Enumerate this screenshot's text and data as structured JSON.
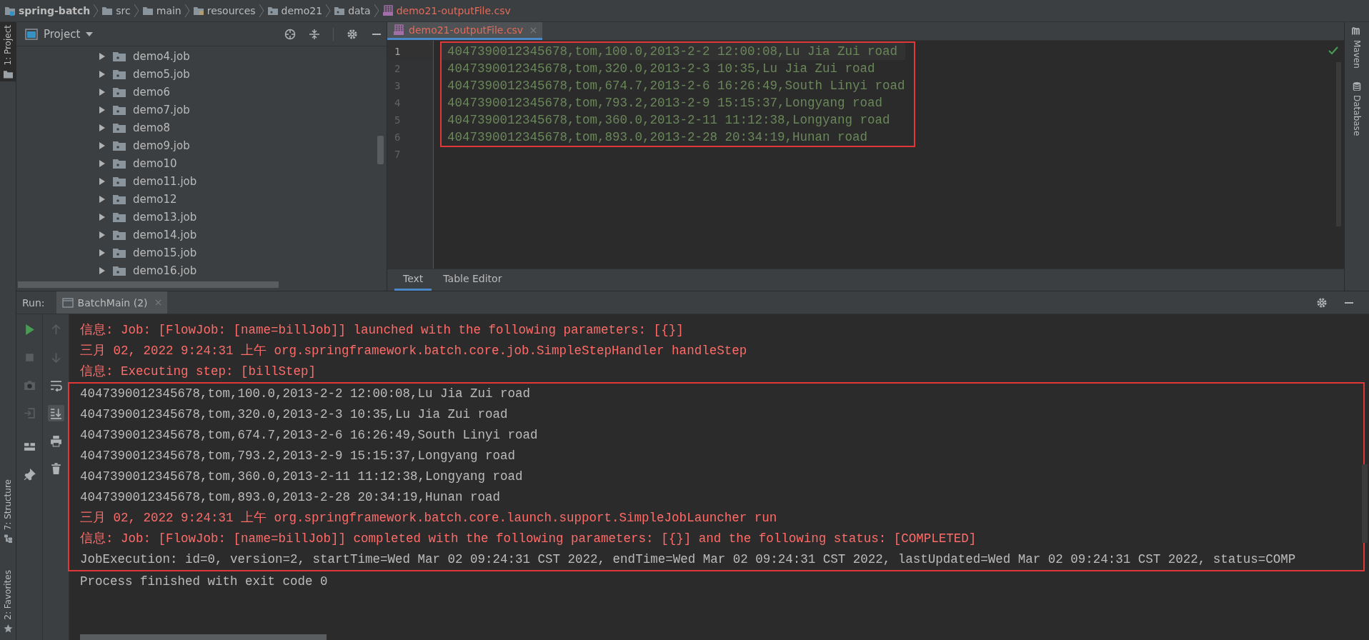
{
  "breadcrumb": [
    {
      "label": "spring-batch",
      "kind": "module"
    },
    {
      "label": "src",
      "kind": "folder"
    },
    {
      "label": "main",
      "kind": "folder"
    },
    {
      "label": "resources",
      "kind": "resources"
    },
    {
      "label": "demo21",
      "kind": "package"
    },
    {
      "label": "data",
      "kind": "package"
    },
    {
      "label": "demo21-outputFile.csv",
      "kind": "csv"
    }
  ],
  "left_strip": {
    "top": {
      "label": "1: Project",
      "selected": true
    },
    "bottom": [
      {
        "label": "7: Structure",
        "kind": "structure"
      },
      {
        "label": "2: Favorites",
        "kind": "favorites"
      }
    ]
  },
  "project": {
    "title": "Project",
    "tree": [
      {
        "label": "demo4.job",
        "expanded": false
      },
      {
        "label": "demo5.job",
        "expanded": false
      },
      {
        "label": "demo6",
        "expanded": false
      },
      {
        "label": "demo7.job",
        "expanded": false
      },
      {
        "label": "demo8",
        "expanded": false
      },
      {
        "label": "demo9.job",
        "expanded": false
      },
      {
        "label": "demo10",
        "expanded": false
      },
      {
        "label": "demo11.job",
        "expanded": false
      },
      {
        "label": "demo12",
        "expanded": false
      },
      {
        "label": "demo13.job",
        "expanded": false
      },
      {
        "label": "demo14.job",
        "expanded": false
      },
      {
        "label": "demo15.job",
        "expanded": false
      },
      {
        "label": "demo16.job",
        "expanded": false
      }
    ]
  },
  "editor": {
    "tabs": [
      {
        "label": "demo21-outputFile.csv",
        "selected": true
      }
    ],
    "blocks": [
      {
        "framed": true,
        "lines": [
          {
            "number": "1",
            "text": "4047390012345678,tom,100.0,2013-2-2 12:00:08,Lu Jia Zui road",
            "current": true
          },
          {
            "number": "2",
            "text": "4047390012345678,tom,320.0,2013-2-3 10:35,Lu Jia Zui road",
            "current": false
          },
          {
            "number": "3",
            "text": "4047390012345678,tom,674.7,2013-2-6 16:26:49,South Linyi road",
            "current": false
          },
          {
            "number": "4",
            "text": "4047390012345678,tom,793.2,2013-2-9 15:15:37,Longyang road",
            "current": false
          },
          {
            "number": "5",
            "text": "4047390012345678,tom,360.0,2013-2-11 11:12:38,Longyang road",
            "current": false
          },
          {
            "number": "6",
            "text": "4047390012345678,tom,893.0,2013-2-28 20:34:19,Hunan road",
            "current": false
          }
        ]
      },
      {
        "framed": false,
        "lines": [
          {
            "number": "7",
            "current": false
          }
        ]
      }
    ],
    "bottom_tabs": [
      {
        "label": "Text",
        "selected": true
      },
      {
        "label": "Table Editor",
        "selected": false
      }
    ]
  },
  "right_strip": [
    {
      "label": "Maven",
      "kind": "maven"
    },
    {
      "label": "Database",
      "kind": "database"
    }
  ],
  "run": {
    "label": "Run:",
    "tabs": [
      {
        "label": "BatchMain (2)",
        "selected": true
      }
    ],
    "console": [
      {
        "framed": false,
        "lines": [
          {
            "kind": "log",
            "text": "信息: Job: [FlowJob: [name=billJob]] launched with the following parameters: [{}]"
          },
          {
            "kind": "log",
            "text": "三月 02, 2022 9:24:31 上午 org.springframework.batch.core.job.SimpleStepHandler handleStep"
          },
          {
            "kind": "log",
            "text": "信息: Executing step: [billStep]"
          }
        ]
      },
      {
        "framed": true,
        "lines": [
          {
            "kind": "out",
            "text": "4047390012345678,tom,100.0,2013-2-2 12:00:08,Lu Jia Zui road"
          },
          {
            "kind": "out",
            "text": "4047390012345678,tom,320.0,2013-2-3 10:35,Lu Jia Zui road"
          },
          {
            "kind": "out",
            "text": "4047390012345678,tom,674.7,2013-2-6 16:26:49,South Linyi road"
          },
          {
            "kind": "out",
            "text": "4047390012345678,tom,793.2,2013-2-9 15:15:37,Longyang road"
          },
          {
            "kind": "out",
            "text": "4047390012345678,tom,360.0,2013-2-11 11:12:38,Longyang road"
          },
          {
            "kind": "out",
            "text": "4047390012345678,tom,893.0,2013-2-28 20:34:19,Hunan road"
          },
          {
            "kind": "log",
            "text": "三月 02, 2022 9:24:31 上午 org.springframework.batch.core.launch.support.SimpleJobLauncher run"
          },
          {
            "kind": "log",
            "text": "信息: Job: [FlowJob: [name=billJob]] completed with the following parameters: [{}] and the following status: [COMPLETED]"
          },
          {
            "kind": "out",
            "text": "JobExecution: id=0, version=2, startTime=Wed Mar 02 09:24:31 CST 2022, endTime=Wed Mar 02 09:24:31 CST 2022, lastUpdated=Wed Mar 02 09:24:31 CST 2022, status=COMP"
          }
        ]
      },
      {
        "framed": false,
        "lines": [
          {
            "kind": "out",
            "text": "Process finished with exit code 0"
          }
        ]
      }
    ]
  }
}
